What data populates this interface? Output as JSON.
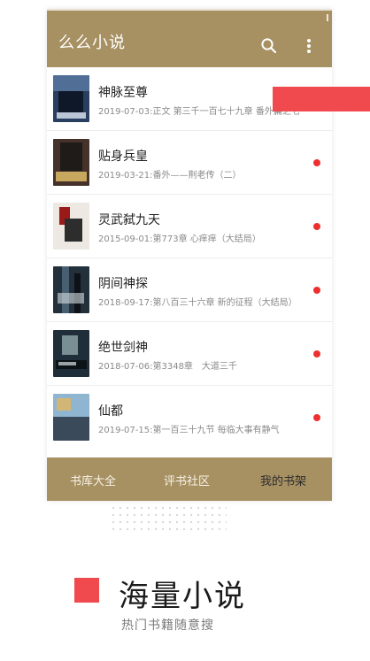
{
  "app": {
    "title": "么么小说",
    "accent_color": "#a79062",
    "unread_color": "#ee2f2f",
    "icons": [
      "search-icon",
      "more-vert-icon"
    ]
  },
  "books": [
    {
      "title": "神脉至尊",
      "subtitle": "2019-07-03:正文 第三千一百七十九章 番外篇之七",
      "unread": false,
      "cover_colors": [
        "#2a3e5f",
        "#0f1828",
        "#6c8fbb"
      ]
    },
    {
      "title": "贴身兵皇",
      "subtitle": "2019-03-21:番外——荆老传（二）",
      "unread": true,
      "cover_colors": [
        "#46322a",
        "#c7a85e",
        "#1e1b19"
      ]
    },
    {
      "title": "灵武弑九天",
      "subtitle": "2015-09-01:第773章 心痒痒（大结局）",
      "unread": true,
      "cover_colors": [
        "#ede8e1",
        "#9a1a1a",
        "#2d2d2d"
      ]
    },
    {
      "title": "阴间神探",
      "subtitle": "2018-09-17:第八百三十六章 新的征程（大结局）",
      "unread": true,
      "cover_colors": [
        "#22303b",
        "#485f72",
        "#0c1217"
      ]
    },
    {
      "title": "绝世剑神",
      "subtitle": "2018-07-06:第3348章　大道三千",
      "unread": true,
      "cover_colors": [
        "#1f2e38",
        "#7a8f94",
        "#0d1418"
      ]
    },
    {
      "title": "仙都",
      "subtitle": "2019-07-15:第一百三十九节 每临大事有静气",
      "unread": true,
      "cover_colors": [
        "#8fb5d1",
        "#d2b675",
        "#3b4a5b"
      ]
    }
  ],
  "tabs": [
    {
      "label": "书库大全",
      "active": false
    },
    {
      "label": "评书社区",
      "active": false
    },
    {
      "label": "我的书架",
      "active": true
    }
  ],
  "feature": {
    "title": "海量小说",
    "subtitle": "热门书籍随意搜",
    "accent_color": "#f04a4f"
  }
}
